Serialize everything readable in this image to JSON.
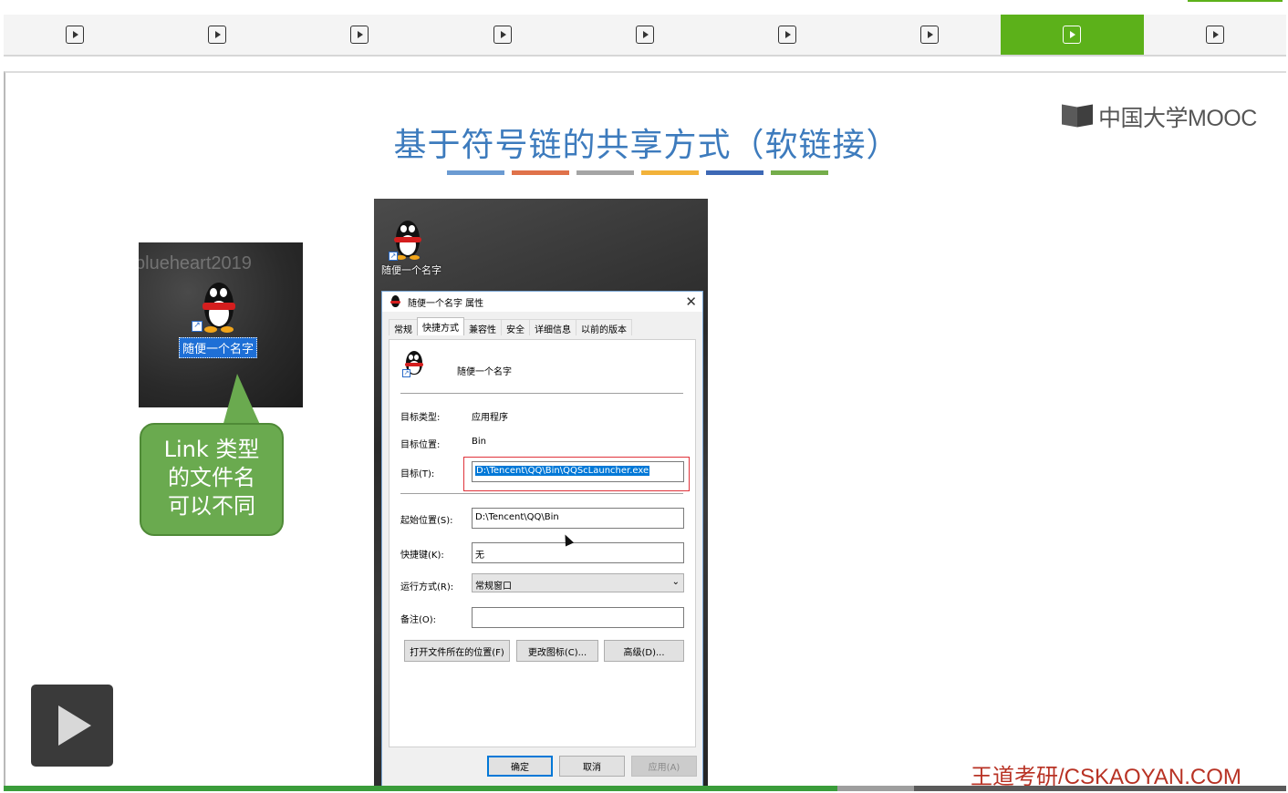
{
  "top_nav": {
    "segments": [
      {
        "icon": "play-box-icon",
        "active": false
      },
      {
        "icon": "play-box-icon",
        "active": false
      },
      {
        "icon": "play-box-icon",
        "active": false
      },
      {
        "icon": "play-box-icon",
        "active": false
      },
      {
        "icon": "play-box-icon",
        "active": false
      },
      {
        "icon": "play-box-icon",
        "active": false
      },
      {
        "icon": "play-box-icon",
        "active": false
      },
      {
        "icon": "play-box-icon",
        "active": true
      },
      {
        "icon": "play-box-icon",
        "active": false
      }
    ],
    "active_color": "#5cb11a"
  },
  "slide": {
    "logo_text": "中国大学MOOC",
    "title": "基于符号链的共享方式（软链接）",
    "title_color": "#3d7bbd",
    "title_bar_colors": [
      "#6b9bd2",
      "#e0724a",
      "#a5a5a5",
      "#f2b23a",
      "#3d68b5",
      "#74ad4a"
    ],
    "thumbnail": {
      "watermark": "blueheart2019",
      "icon_label": "随便一个名字"
    },
    "callout": {
      "line1": "Link 类型",
      "line2": "的文件名",
      "line3": "可以不同",
      "color": "#6aaa4f"
    },
    "desktop": {
      "icon_label": "随便一个名字"
    },
    "dialog": {
      "title": "随便一个名字 属性",
      "tabs": [
        "常规",
        "快捷方式",
        "兼容性",
        "安全",
        "详细信息",
        "以前的版本"
      ],
      "active_tab": "快捷方式",
      "shortcut_name": "随便一个名字",
      "target_type_label": "目标类型:",
      "target_type_value": "应用程序",
      "target_location_label": "目标位置:",
      "target_location_value": "Bin",
      "target_label": "目标(T):",
      "target_value": "D:\\Tencent\\QQ\\Bin\\QQScLauncher.exe",
      "start_in_label": "起始位置(S):",
      "start_in_value": "D:\\Tencent\\QQ\\Bin",
      "shortcut_key_label": "快捷键(K):",
      "shortcut_key_value": "无",
      "run_label": "运行方式(R):",
      "run_value": "常规窗口",
      "comment_label": "备注(O):",
      "comment_value": "",
      "btn_open_location": "打开文件所在的位置(F)",
      "btn_change_icon": "更改图标(C)...",
      "btn_advanced": "高级(D)...",
      "btn_ok": "确定",
      "btn_cancel": "取消",
      "btn_apply": "应用(A)"
    },
    "footer_watermark": "王道考研/CSKAOYAN.COM"
  },
  "player": {
    "progress": 0.65,
    "buffered": 0.71
  }
}
